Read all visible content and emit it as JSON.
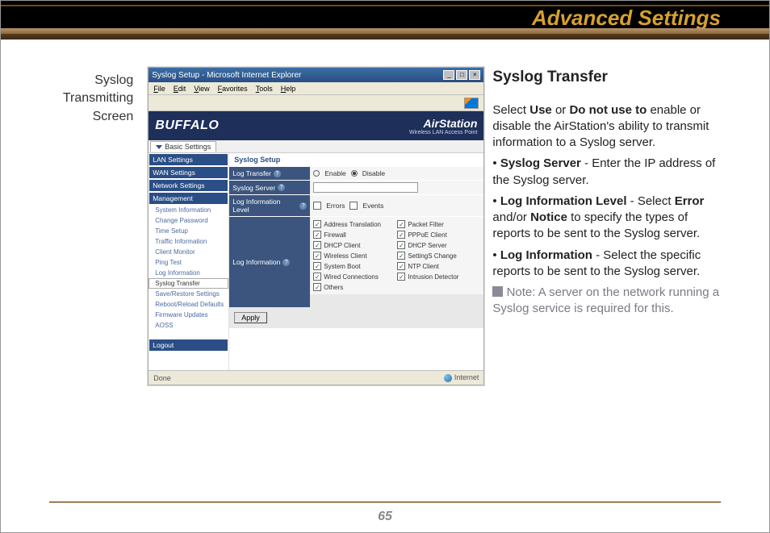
{
  "header_title": "Advanced Settings",
  "caption": {
    "l1": "Syslog",
    "l2": "Transmitting",
    "l3": "Screen"
  },
  "screenshot": {
    "window_title": "Syslog Setup - Microsoft Internet Explorer",
    "menus": [
      "File",
      "Edit",
      "View",
      "Favorites",
      "Tools",
      "Help"
    ],
    "basic_tab": "Basic Settings",
    "brand": "BUFFALO",
    "product": "AirStation",
    "product_sub": "Wireless LAN Access Point",
    "sidebar_headers": [
      "LAN Settings",
      "WAN Settings",
      "Network Settings",
      "Management"
    ],
    "sidebar_items": [
      "System Information",
      "Change Password",
      "Time Setup",
      "Traffic Information",
      "Client Monitor",
      "Ping Test",
      "Log Information",
      "Syslog Transfer",
      "Save/Restore Settings",
      "Reboot/Reload Defaults",
      "Firmware Updates",
      "AOSS"
    ],
    "sidebar_logout": "Logout",
    "panel_title": "Syslog Setup",
    "rows": {
      "log_transfer": {
        "label": "Log Transfer",
        "enable": "Enable",
        "disable": "Disable"
      },
      "syslog_server": {
        "label": "Syslog Server"
      },
      "log_level": {
        "label": "Log Information Level",
        "errors": "Errors",
        "events": "Events"
      },
      "log_info": {
        "label": "Log Information"
      }
    },
    "checks": [
      [
        "Address Translation",
        "Packet Filter"
      ],
      [
        "Firewall",
        "PPPoE Client"
      ],
      [
        "DHCP Client",
        "DHCP Server"
      ],
      [
        "Wireless Client",
        "SettingS Change"
      ],
      [
        "System Boot",
        "NTP Client"
      ],
      [
        "Wired Connections",
        "Intrusion Detector"
      ],
      [
        "Others",
        ""
      ]
    ],
    "apply": "Apply",
    "status_done": "Done",
    "status_zone": "Internet"
  },
  "right": {
    "heading": "Syslog Transfer",
    "p1_a": "Select ",
    "p1_b": "Use",
    "p1_c": " or ",
    "p1_d": "Do not use to",
    "p1_e": " enable or disable the AirStation's ability to transmit information to a Syslog server.",
    "b2_a": "• ",
    "b2_b": "Syslog Server",
    "b2_c": " - Enter the IP address of the Syslog server.",
    "b3_a": "• ",
    "b3_b": "Log Information Level ",
    "b3_c": "- Select ",
    "b3_d": "Error",
    "b3_e": " and/or ",
    "b3_f": "Notice",
    "b3_g": " to specify the types of reports to be sent to the Syslog server.",
    "b4_a": "• ",
    "b4_b": "Log Information",
    "b4_c": " - Select the specific reports to be sent to the Syslog server.",
    "note_label": "Note:  ",
    "note_text": "A server on the net­work running a Syslog service is required for this."
  },
  "page_number": "65"
}
